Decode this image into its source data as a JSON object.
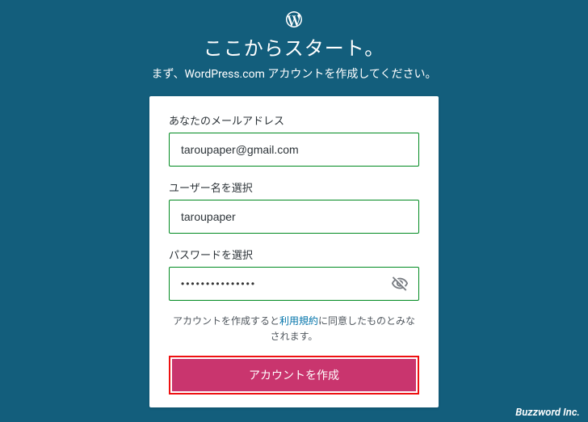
{
  "header": {
    "title": "ここからスタート。",
    "subtitle": "まず、WordPress.com アカウントを作成してください。"
  },
  "form": {
    "email": {
      "label": "あなたのメールアドレス",
      "value": "taroupaper@gmail.com"
    },
    "username": {
      "label": "ユーザー名を選択",
      "value": "taroupaper"
    },
    "password": {
      "label": "パスワードを選択",
      "value": "•••••••••••••••"
    },
    "terms_prefix": "アカウントを作成すると",
    "terms_link": "利用規約",
    "terms_suffix": "に同意したものとみなされます。",
    "submit_label": "アカウントを作成"
  },
  "footer": "Buzzword Inc."
}
